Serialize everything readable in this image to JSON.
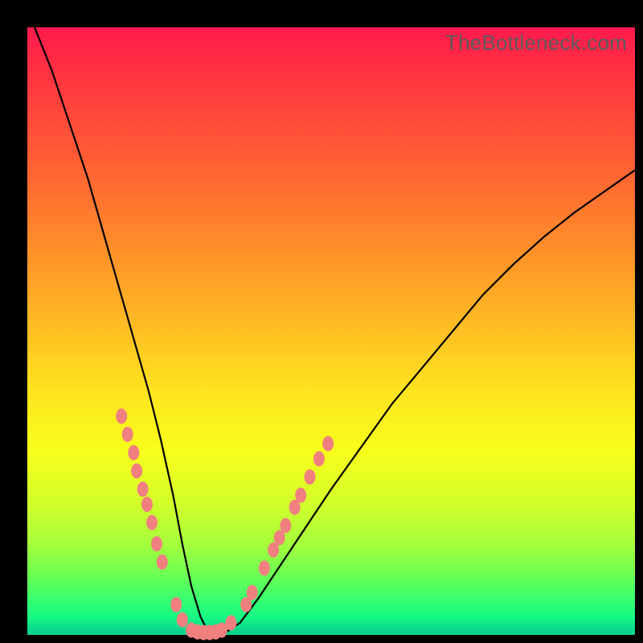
{
  "watermark": "TheBottleneck.com",
  "colors": {
    "frame": "#000000",
    "gradient_top": "#ff1a4d",
    "gradient_bottom": "#08cf8a",
    "curve": "#000000",
    "marker": "#f08080"
  },
  "chart_data": {
    "type": "line",
    "title": "",
    "xlabel": "",
    "ylabel": "",
    "xlim": [
      0,
      100
    ],
    "ylim": [
      0,
      100
    ],
    "grid": false,
    "series": [
      {
        "name": "bottleneck-curve",
        "x": [
          0,
          2,
          4,
          6,
          8,
          10,
          12,
          14,
          16,
          18,
          20,
          22,
          24,
          25.5,
          27,
          28.5,
          30,
          32,
          35,
          38,
          42,
          46,
          50,
          55,
          60,
          65,
          70,
          75,
          80,
          85,
          90,
          95,
          100
        ],
        "y": [
          103,
          98,
          93,
          87,
          81,
          75,
          68,
          61,
          54,
          47,
          40,
          32,
          23,
          15,
          8,
          3,
          0,
          0,
          2,
          6,
          12,
          18,
          24,
          31,
          38,
          44,
          50,
          56,
          61,
          65.5,
          69.5,
          73,
          76.5
        ]
      }
    ],
    "markers": {
      "name": "highlight-points",
      "points": [
        {
          "x": 15.5,
          "y": 36
        },
        {
          "x": 16.5,
          "y": 33
        },
        {
          "x": 17.5,
          "y": 30
        },
        {
          "x": 18.0,
          "y": 27
        },
        {
          "x": 19.0,
          "y": 24
        },
        {
          "x": 19.7,
          "y": 21.5
        },
        {
          "x": 20.5,
          "y": 18.5
        },
        {
          "x": 21.3,
          "y": 15
        },
        {
          "x": 22.2,
          "y": 12
        },
        {
          "x": 24.5,
          "y": 5
        },
        {
          "x": 25.5,
          "y": 2.5
        },
        {
          "x": 27.0,
          "y": 0.8
        },
        {
          "x": 28.0,
          "y": 0.5
        },
        {
          "x": 29.0,
          "y": 0.4
        },
        {
          "x": 30.0,
          "y": 0.4
        },
        {
          "x": 31.0,
          "y": 0.5
        },
        {
          "x": 32.0,
          "y": 0.8
        },
        {
          "x": 33.5,
          "y": 2
        },
        {
          "x": 36.0,
          "y": 5
        },
        {
          "x": 37.0,
          "y": 7
        },
        {
          "x": 39.0,
          "y": 11
        },
        {
          "x": 40.5,
          "y": 14
        },
        {
          "x": 41.5,
          "y": 16
        },
        {
          "x": 42.5,
          "y": 18
        },
        {
          "x": 44.0,
          "y": 21
        },
        {
          "x": 45.0,
          "y": 23
        },
        {
          "x": 46.5,
          "y": 26
        },
        {
          "x": 48.0,
          "y": 29
        },
        {
          "x": 49.5,
          "y": 31.5
        }
      ]
    }
  }
}
